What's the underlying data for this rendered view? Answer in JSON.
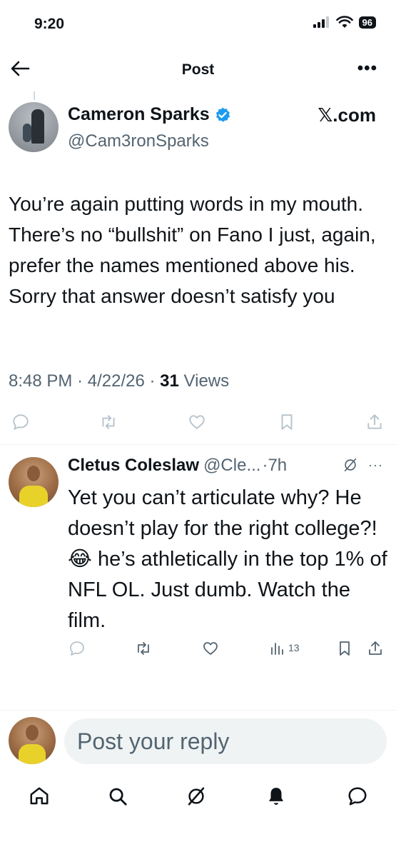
{
  "status_bar": {
    "time": "9:20",
    "battery": "96"
  },
  "header": {
    "title": "Post"
  },
  "post": {
    "author_name": "Cameron Sparks",
    "author_handle": "@Cam3ronSparks",
    "source_badge": "𝕏.com",
    "text": "You’re again putting words in my mouth. There’s no “bullshit” on Fano I just, again, prefer the names mentioned above his. Sorry that answer doesn’t satisfy you",
    "time": "8:48 PM",
    "date": "4/22/26",
    "views_count": "31",
    "views_label": "Views"
  },
  "reply": {
    "author_name": "Cletus Coleslaw",
    "author_handle": "@Cle...",
    "age": "·7h",
    "text": "Yet you can’t articulate why? He doesn’t play for the right college?! 😂 he’s athletically in the top 1% of NFL OL. Just dumb. Watch the film.",
    "views": "13"
  },
  "composer": {
    "placeholder": "Post your reply"
  },
  "icons": {
    "post_actions": [
      "reply-icon",
      "repost-icon",
      "like-icon",
      "bookmark-icon",
      "share-icon"
    ],
    "reply_actions": [
      "reply-icon",
      "repost-icon",
      "like-icon",
      "analytics-icon",
      "bookmark-icon",
      "share-icon"
    ],
    "nav": [
      "home-icon",
      "search-icon",
      "grok-icon",
      "notifications-icon",
      "messages-icon"
    ]
  },
  "colors": {
    "text": "#0f1419",
    "secondary": "#536471",
    "verified": "#1d9bf0",
    "action_light": "#b8c4cc"
  }
}
